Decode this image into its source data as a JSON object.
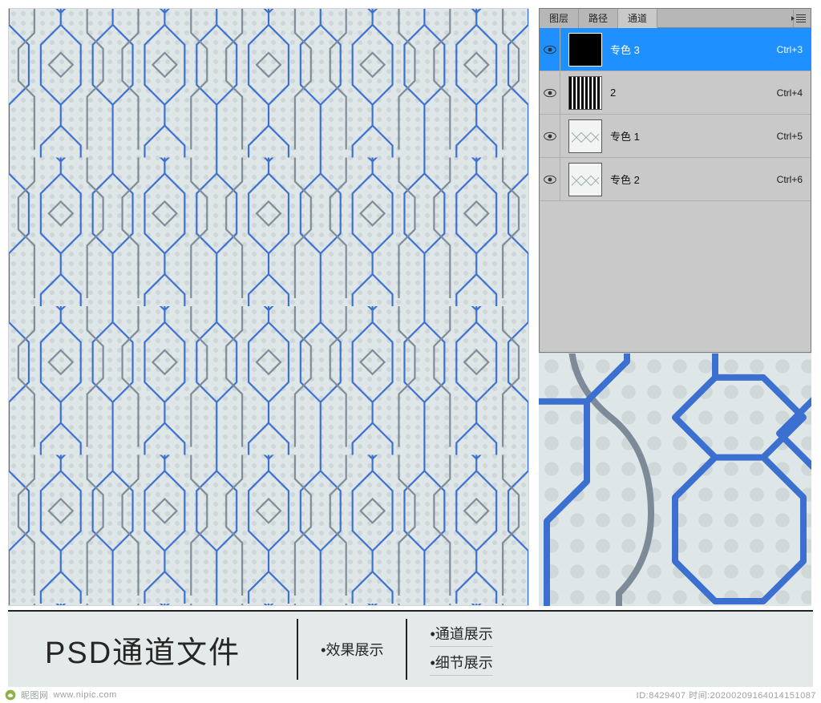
{
  "panel": {
    "tabs": {
      "layers": "图层",
      "paths": "路径",
      "channels": "通道"
    },
    "channels": [
      {
        "thumb": "black",
        "label": "专色 3",
        "shortcut": "Ctrl+3",
        "selected": true
      },
      {
        "thumb": "stripes",
        "label": "2",
        "shortcut": "Ctrl+4",
        "selected": false
      },
      {
        "thumb": "light",
        "label": "专色 1",
        "shortcut": "Ctrl+5",
        "selected": false
      },
      {
        "thumb": "light",
        "label": "专色 2",
        "shortcut": "Ctrl+6",
        "selected": false
      }
    ]
  },
  "bottom": {
    "title": "PSD通道文件",
    "mid": "•效果展示",
    "right": [
      "•通道展示",
      "•细节展示"
    ]
  },
  "watermark": {
    "left_site": "昵图网",
    "left_url": "www.nipic.com",
    "right_id": "ID:8429407 时间:20200209164014151087"
  }
}
